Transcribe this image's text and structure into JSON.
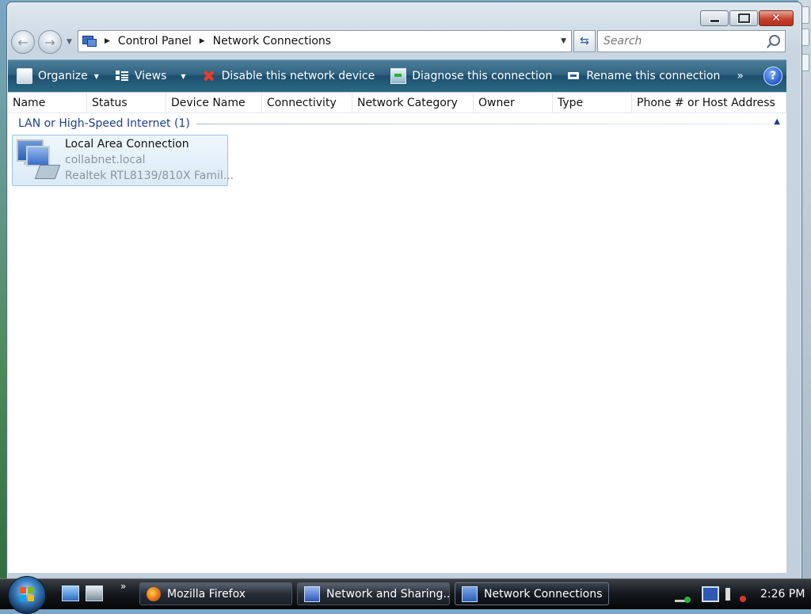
{
  "window": {
    "caption_buttons": [
      "minimize",
      "maximize",
      "close"
    ]
  },
  "address_bar": {
    "crumbs": [
      "Control Panel",
      "Network Connections"
    ]
  },
  "search": {
    "placeholder": "Search"
  },
  "command_bar": {
    "organize": "Organize",
    "views": "Views",
    "disable": "Disable this network device",
    "diagnose": "Diagnose this connection",
    "rename": "Rename this connection",
    "more": "»",
    "help": "?"
  },
  "columns": [
    {
      "label": "Name"
    },
    {
      "label": "Status"
    },
    {
      "label": "Device Name"
    },
    {
      "label": "Connectivity"
    },
    {
      "label": "Network Category"
    },
    {
      "label": "Owner"
    },
    {
      "label": "Type"
    },
    {
      "label": "Phone # or Host Address"
    }
  ],
  "group": {
    "label": "LAN or High-Speed Internet (1)"
  },
  "connection": {
    "name": "Local Area Connection",
    "network": "collabnet.local",
    "device": "Realtek RTL8139/810X Famil..."
  },
  "taskbar": {
    "ql_more": "»",
    "tasks": [
      {
        "label": "Mozilla Firefox",
        "icon": "firefox-icon"
      },
      {
        "label": "Network and Sharing...",
        "icon": "network-sharing-icon"
      },
      {
        "label": "Network Connections",
        "icon": "network-connections-icon"
      }
    ],
    "clock": "2:26 PM"
  },
  "colors": {
    "command_bar": "#2e6280",
    "group_label": "#1e3f8a",
    "tile_border": "#9cc3e2"
  }
}
